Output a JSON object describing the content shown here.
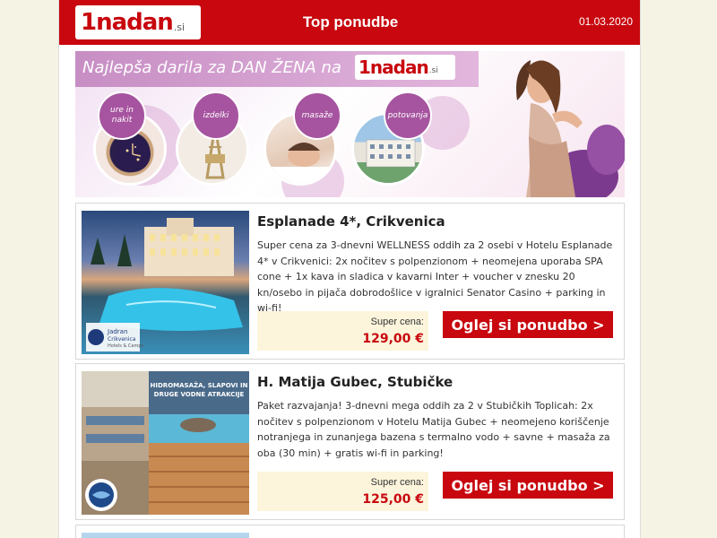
{
  "header": {
    "logo_text": "1nadan",
    "logo_suffix": ".si",
    "title": "Top ponudbe",
    "date": "01.03.2020"
  },
  "banner": {
    "headline": "Najlepša darila za DAN ŽENA na",
    "brand_text": "1nadan",
    "brand_suffix": ".si",
    "categories": [
      {
        "label": "ure in nakit"
      },
      {
        "label": "izdelki"
      },
      {
        "label": "masaže"
      },
      {
        "label": "potovanja"
      }
    ]
  },
  "offers": [
    {
      "title": "Esplanade 4*, Crikvenica",
      "description": "Super cena za 3-dnevni WELLNESS oddih za 2 osebi v Hotelu Esplanade 4* v Crikvenici: 2x nočitev s polpenzionom + neomejena uporaba SPA cone + 1x kava in sladica v kavarni Inter + voucher v znesku 20 kn/osebo in pijača dobrodošlice v igralnici Senator Casino + parking in wi-fi!",
      "price_label": "Super cena:",
      "price": "129,00 €",
      "cta": "Oglej si ponudbo >",
      "image_caption": "Jadran Crikvenica Hotels & Camps"
    },
    {
      "title": "H. Matija Gubec, Stubičke",
      "description": "Paket razvajanja! 3-dnevni mega oddih za 2 v Stubičkih Toplicah: 2x nočitev s polpenzionom v Hotelu Matija Gubec + neomejeno koriščenje notranjega in zunanjega bazena s termalno vodo + savne + masaža za oba (30 min) + gratis wi-fi in parking!",
      "price_label": "Super cena:",
      "price": "125,00 €",
      "cta": "Oglej si ponudbo >",
      "image_caption": "HIDROMASAŽA, SLAPOVI IN DRUGE VODNE ATRAKCIJE"
    }
  ],
  "colors": {
    "brand_red": "#c8070e",
    "price_bg": "#fcf5dc",
    "banner_purple": "#a6549f",
    "page_bg": "#f5f3e4"
  }
}
